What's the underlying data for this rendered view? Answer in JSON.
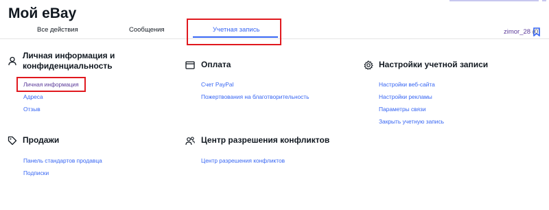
{
  "page": {
    "title": "Мой eBay"
  },
  "tabs": [
    {
      "label": "Все действия"
    },
    {
      "label": "Сообщения"
    },
    {
      "label": "Учетная запись"
    }
  ],
  "user": {
    "name": "zimor_28",
    "score": "(0)"
  },
  "sections": {
    "personal": {
      "title_line1": "Личная информация и",
      "title_line2": "конфиденциальность",
      "icon": "person-icon",
      "links": [
        "Личная информация",
        "Адреса",
        "Отзыв"
      ]
    },
    "payment": {
      "title": "Оплата",
      "icon": "wallet-icon",
      "links": [
        "Счет PayPal",
        "Пожертвования на благотворительность"
      ]
    },
    "settings": {
      "title": "Настройки учетной записи",
      "icon": "gear-icon",
      "links": [
        "Настройки веб-сайта",
        "Настройки рекламы",
        "Параметры связи",
        "Закрыть учетную запись"
      ]
    },
    "selling": {
      "title": "Продажи",
      "icon": "tag-icon",
      "links": [
        "Панель стандартов продавца",
        "Подписки"
      ]
    },
    "disputes": {
      "title": "Центр разрешения конфликтов",
      "icon": "people-icon",
      "links": [
        "Центр разрешения конфликтов"
      ]
    }
  },
  "colors": {
    "link": "#3665f3",
    "visited": "#5b3a9a",
    "highlight": "#e0181e"
  }
}
